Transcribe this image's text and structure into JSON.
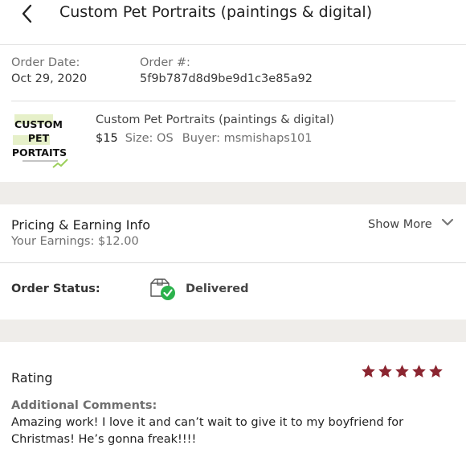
{
  "header": {
    "title": "Custom Pet Portraits (paintings & digital)"
  },
  "order": {
    "date_label": "Order Date:",
    "date_value": "Oct 29, 2020",
    "number_label": "Order #:",
    "number_value": "5f9b787d8d9be9d1c3e85a92"
  },
  "item": {
    "thumbnail_text": [
      "CUSTOM",
      "PET",
      "PORTAITS"
    ],
    "title": "Custom Pet Portraits (paintings & digital)",
    "price": "$15",
    "size": "Size: OS",
    "buyer": "Buyer: msmishaps101"
  },
  "pricing": {
    "title": "Pricing & Earning Info",
    "earnings": "Your Earnings: $12.00",
    "show_more": "Show More"
  },
  "status": {
    "label": "Order Status:",
    "value": "Delivered",
    "icon": "delivered-box-check-icon"
  },
  "rating": {
    "title": "Rating",
    "stars": 5,
    "max_stars": 5,
    "comments_label": "Additional Comments:",
    "comments": "Amazing work! I love it and can’t wait to give it to my boyfriend for Christmas! He’s gonna freak!!!!"
  },
  "colors": {
    "star": "#8b2530",
    "check": "#2bb24c",
    "gap": "#efedea"
  }
}
